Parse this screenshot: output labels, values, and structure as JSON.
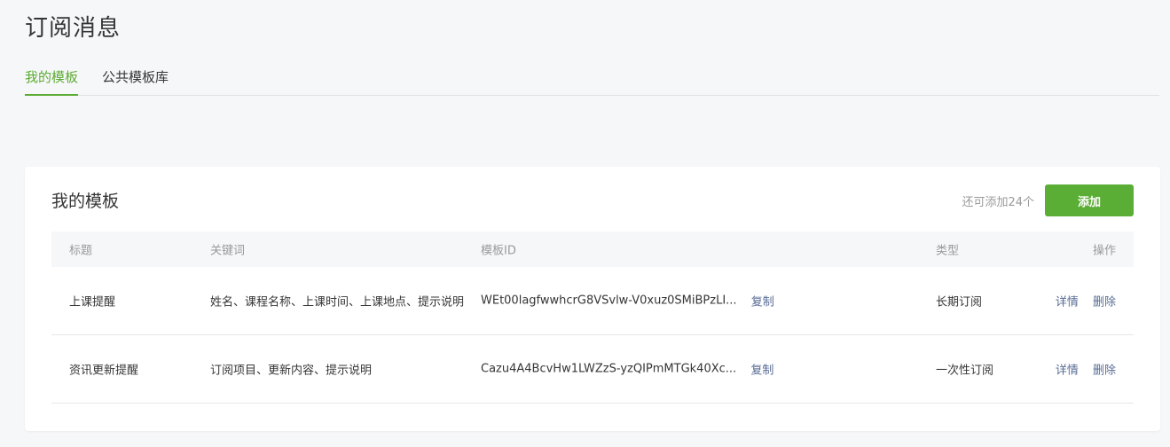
{
  "header": {
    "title": "订阅消息"
  },
  "tabs": [
    {
      "label": "我的模板",
      "active": true
    },
    {
      "label": "公共模板库",
      "active": false
    }
  ],
  "card": {
    "title": "我的模板",
    "quota_text": "还可添加24个",
    "add_label": "添加"
  },
  "table": {
    "columns": [
      "标题",
      "关键词",
      "模板ID",
      "类型",
      "操作"
    ],
    "rows": [
      {
        "title": "上课提醒",
        "keywords": "姓名、课程名称、上课时间、上课地点、提示说明",
        "template_id": "WEt00lagfwwhcrG8VSvlw-V0xuz0SMiBPzLI...",
        "copy_label": "复制",
        "type": "长期订阅",
        "detail_label": "详情",
        "delete_label": "删除"
      },
      {
        "title": "资讯更新提醒",
        "keywords": "订阅项目、更新内容、提示说明",
        "template_id": "Cazu4A4BcvHw1LWZzS-yzQIPmMTGk40Xc...",
        "copy_label": "复制",
        "type": "一次性订阅",
        "detail_label": "详情",
        "delete_label": "删除"
      }
    ]
  },
  "colors": {
    "accent": "#5aad35",
    "link": "#576b95",
    "background": "#f6f7f9"
  }
}
